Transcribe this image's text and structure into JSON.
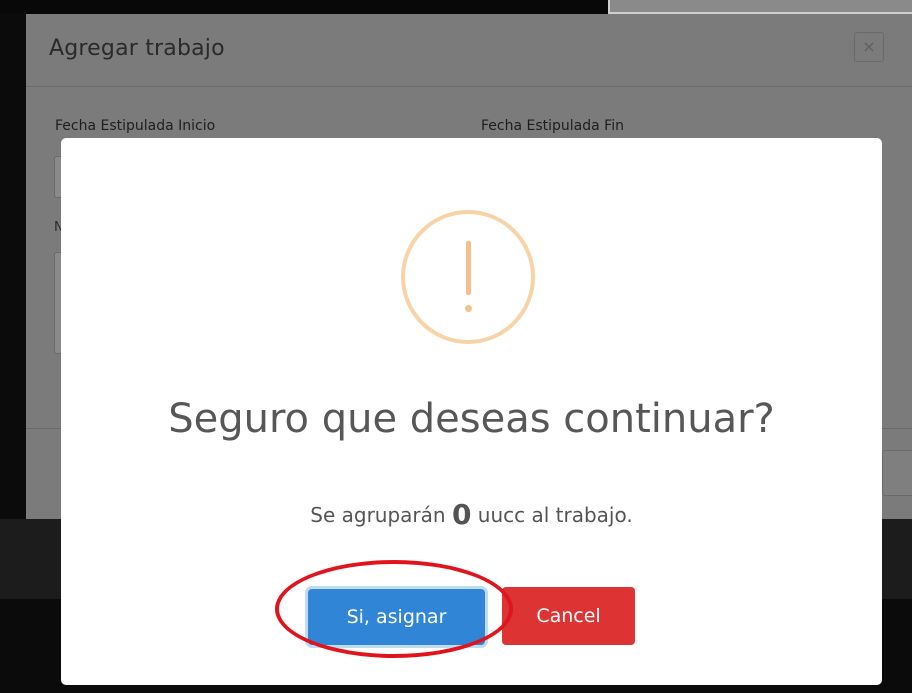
{
  "background_modal": {
    "title": "Agregar trabajo",
    "close_symbol": "×",
    "labels": {
      "start_date": "Fecha Estipulada Inicio",
      "end_date": "Fecha Estipulada Fin",
      "partial_label": "N"
    }
  },
  "alert": {
    "icon": "warning-exclamation-icon",
    "title": "Seguro que deseas continuar?",
    "text_before": "Se agruparán ",
    "count": "0",
    "text_after": " uucc al trabajo.",
    "confirm_label": "Si, asignar",
    "cancel_label": "Cancel"
  },
  "colors": {
    "confirm": "#3085d6",
    "cancel": "#dd3333",
    "warning": "#f8bb86",
    "highlight_annotation": "#e0141c"
  }
}
